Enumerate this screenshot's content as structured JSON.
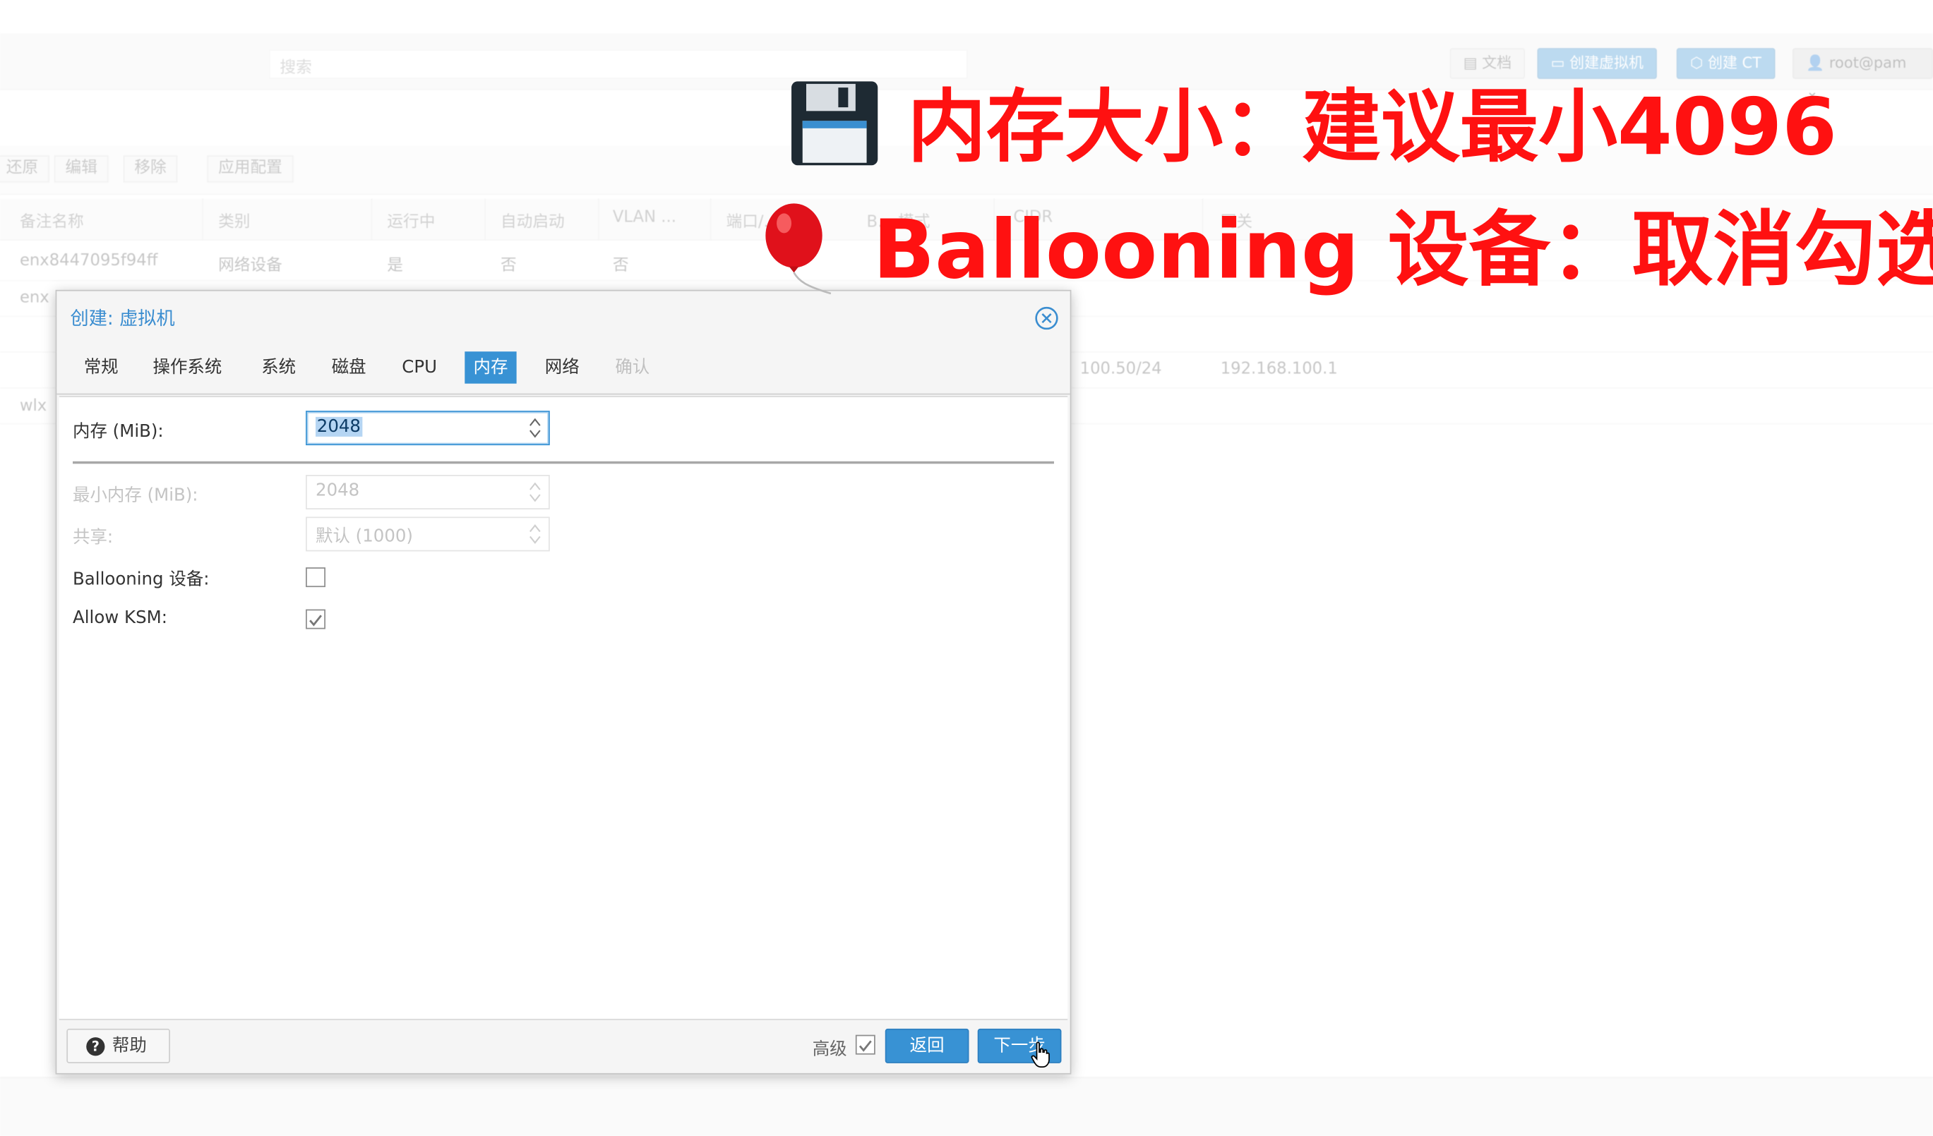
{
  "background": {
    "search_placeholder": "搜索",
    "top_buttons": {
      "docs": "文档",
      "create_vm": "创建虚拟机",
      "create_ct": "创建 CT",
      "user": "root@pam"
    },
    "toolbar2": [
      "还原",
      "编辑",
      "移除",
      "应用配置"
    ],
    "grid_headers": [
      "备注名称",
      "类别",
      "运行中",
      "自动启动",
      "VLAN ...",
      "端口/...",
      "B... 模式",
      "CIDR",
      "网关"
    ],
    "rows": [
      {
        "name": "enx8447095f94ff",
        "type": "网络设备",
        "running": "是",
        "autostart": "否",
        "vlan": "否"
      },
      {
        "name": "enx"
      },
      {
        "name": "",
        "cidr": "100.50/24",
        "gateway": "192.168.100.1"
      },
      {
        "name": "wlx"
      }
    ]
  },
  "dialog": {
    "title": "创建: 虚拟机",
    "tabs": [
      {
        "label": "常规",
        "state": "normal"
      },
      {
        "label": "操作系统",
        "state": "normal"
      },
      {
        "label": "系统",
        "state": "normal"
      },
      {
        "label": "磁盘",
        "state": "normal"
      },
      {
        "label": "CPU",
        "state": "normal"
      },
      {
        "label": "内存",
        "state": "active"
      },
      {
        "label": "网络",
        "state": "normal"
      },
      {
        "label": "确认",
        "state": "disabled"
      }
    ],
    "fields": {
      "memory_label": "内存 (MiB):",
      "memory_value": "2048",
      "min_memory_label": "最小内存 (MiB):",
      "min_memory_value": "2048",
      "shares_label": "共享:",
      "shares_value": "默认 (1000)",
      "ballooning_label": "Ballooning 设备:",
      "ballooning_checked": false,
      "ksm_label": "Allow KSM:",
      "ksm_checked": true
    },
    "footer": {
      "help": "帮助",
      "advanced": "高级",
      "advanced_checked": true,
      "back": "返回",
      "next": "下一步"
    }
  },
  "annotations": {
    "line1": "内存大小：建议最小4096",
    "line2": "Ballooning 设备：取消勾选",
    "color": "#ff1111"
  }
}
